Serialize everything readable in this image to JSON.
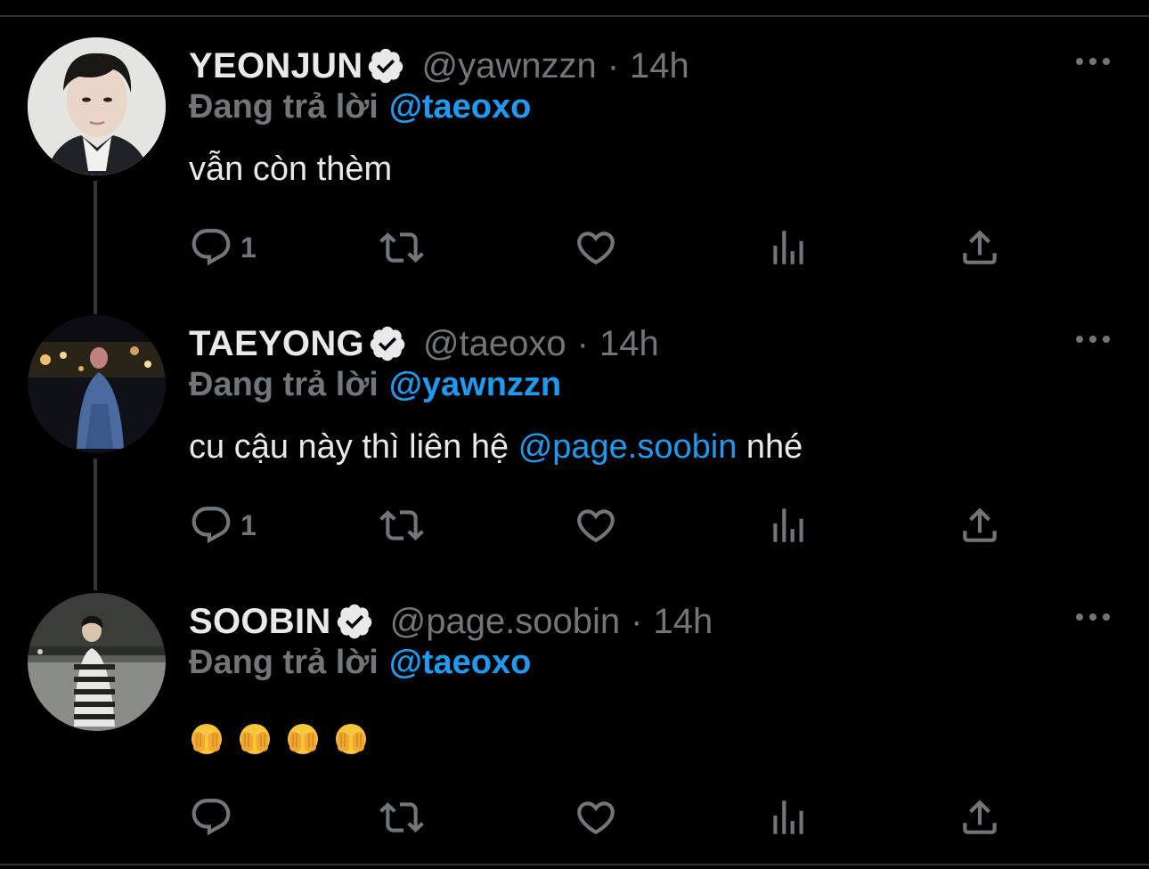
{
  "tweets": [
    {
      "name": "YEONJUN",
      "handle": "@yawnzzn",
      "dot": "·",
      "time": "14h",
      "reply_label": "Đang trả lời",
      "reply_to": "@taeoxo",
      "text": "vẫn còn thèm",
      "replies": "1"
    },
    {
      "name": "TAEYONG",
      "handle": "@taeoxo",
      "dot": "·",
      "time": "14h",
      "reply_label": "Đang trả lời",
      "reply_to": "@yawnzzn",
      "text_before": "cu cậu này thì liên hệ ",
      "text_mention": "@page.soobin",
      "text_after": " nhé",
      "replies": "1"
    },
    {
      "name": "SOOBIN",
      "handle": "@page.soobin",
      "dot": "·",
      "time": "14h",
      "reply_label": "Đang trả lời",
      "reply_to": "@taeoxo",
      "emojis": [
        "face-with-peeking-eye",
        "face-with-peeking-eye",
        "face-with-peeking-eye",
        "face-with-peeking-eye"
      ],
      "replies": ""
    }
  ],
  "icons": {
    "reply": "reply-icon",
    "retweet": "retweet-icon",
    "like": "heart-icon",
    "views": "bar-chart-icon",
    "share": "share-icon",
    "more": "more-icon",
    "verified": "verified-badge-icon"
  },
  "colors": {
    "background": "#000000",
    "text": "#e7e9ea",
    "muted": "#71767b",
    "link": "#1d9bf0",
    "thread_line": "#333639"
  }
}
